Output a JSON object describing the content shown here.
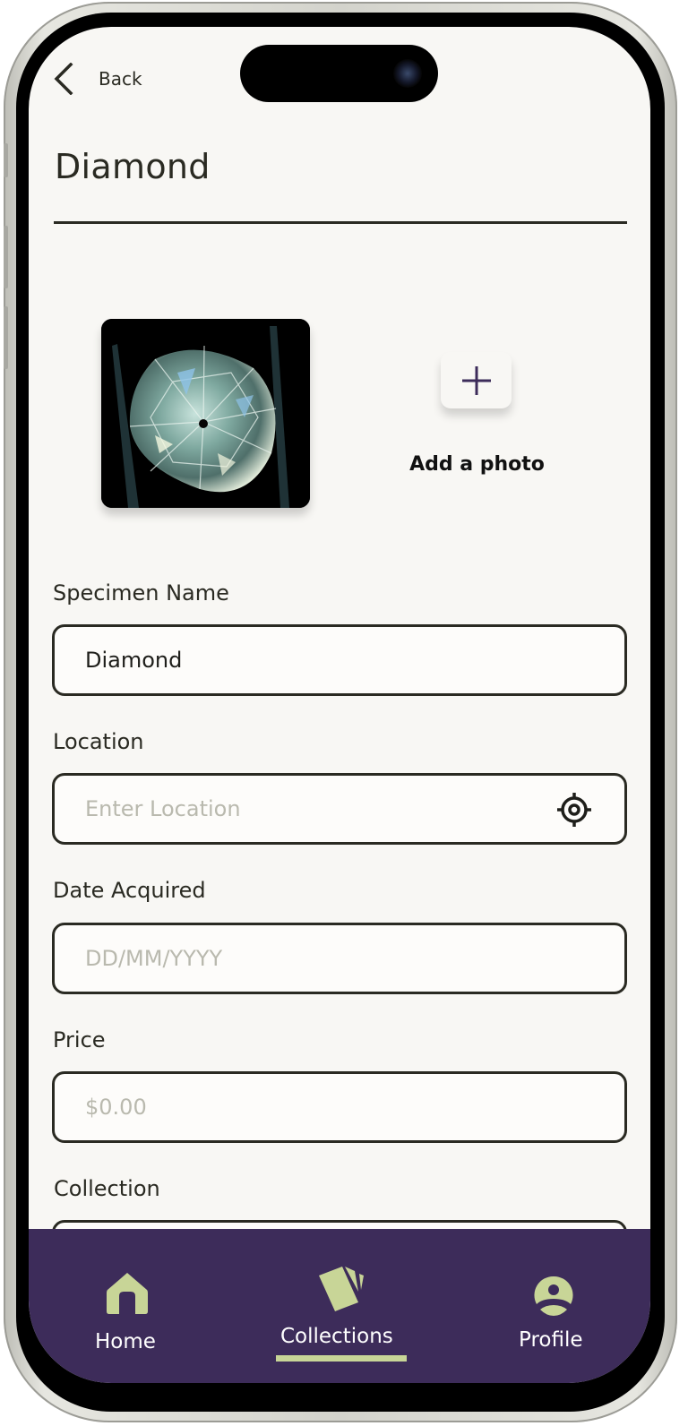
{
  "header": {
    "back_label": "Back",
    "title": "Diamond"
  },
  "photos": {
    "specimen_photo_alt": "Diamond specimen held in tweezers",
    "add_photo_label": "Add a photo"
  },
  "form": {
    "fields": [
      {
        "label": "Specimen Name",
        "value": "Diamond",
        "placeholder": ""
      },
      {
        "label": "Location",
        "value": "",
        "placeholder": "Enter Location",
        "icon": "location-target-icon"
      },
      {
        "label": "Date Acquired",
        "value": "",
        "placeholder": "DD/MM/YYYY"
      },
      {
        "label": "Price",
        "value": "",
        "placeholder": "$0.00"
      },
      {
        "label": "Collection",
        "value": "",
        "placeholder": ""
      }
    ]
  },
  "nav": {
    "items": [
      {
        "label": "Home",
        "icon": "home-icon",
        "active": false
      },
      {
        "label": "Collections",
        "icon": "collections-cards-icon",
        "active": true
      },
      {
        "label": "Profile",
        "icon": "profile-icon",
        "active": false
      }
    ]
  },
  "colors": {
    "background": "#f8f7f4",
    "text": "#2a2a22",
    "placeholder": "#b9b9ae",
    "nav_background": "#3d2c5a",
    "nav_accent": "#c8d597",
    "plus_icon": "#3d2c5a"
  }
}
